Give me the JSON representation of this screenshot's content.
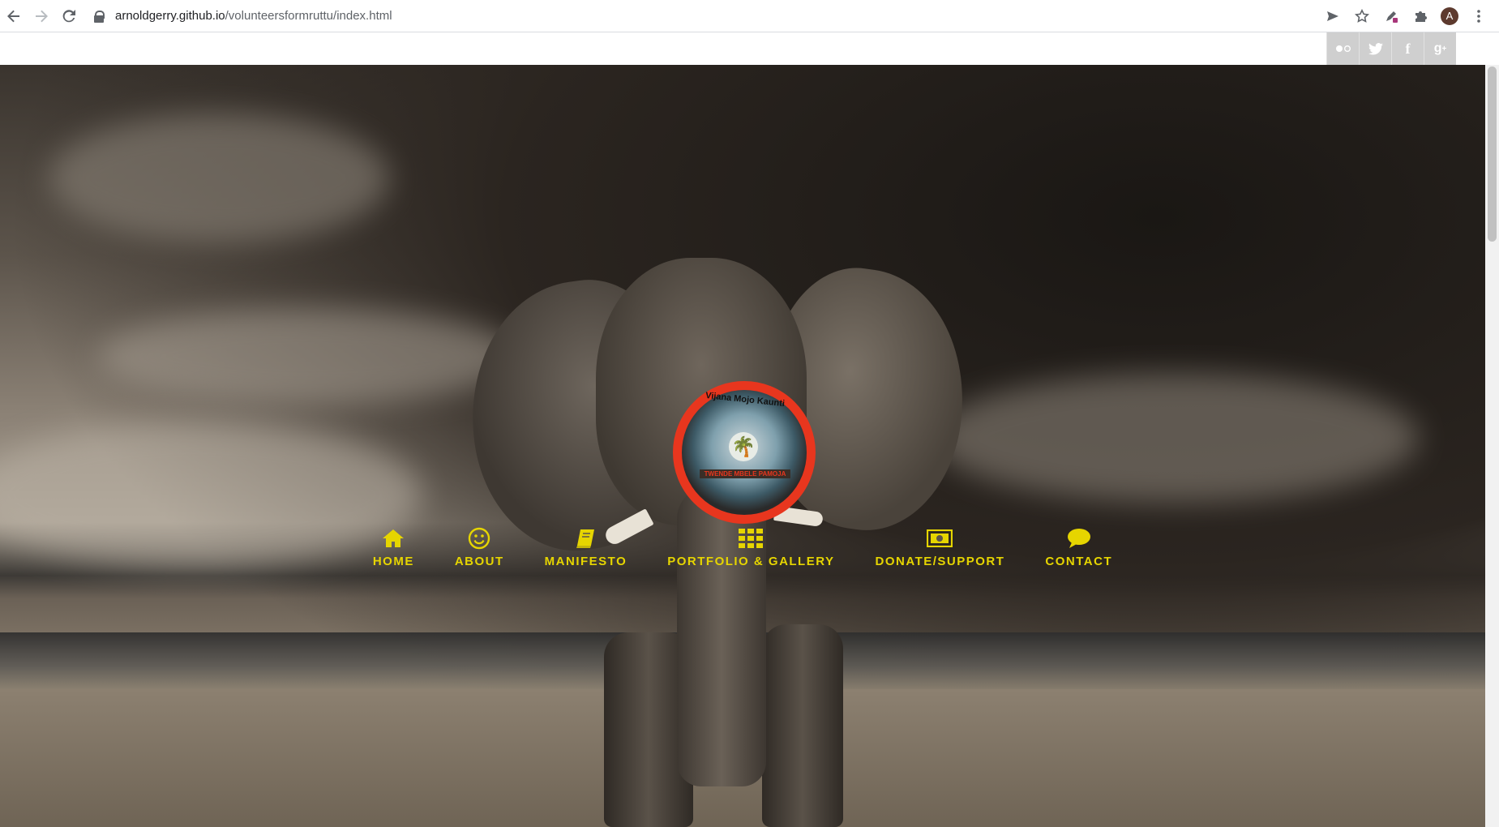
{
  "browser": {
    "url_host": "arnoldgerry.github.io",
    "url_path": "/volunteersformruttu/index.html",
    "avatar_letter": "A"
  },
  "social": {
    "items": [
      {
        "name": "flickr",
        "glyph": "●○"
      },
      {
        "name": "twitter",
        "glyph": "🐦"
      },
      {
        "name": "facebook",
        "glyph": "f"
      },
      {
        "name": "google-plus",
        "glyph": "g+"
      }
    ]
  },
  "logo": {
    "top_text": "Vijana Mojo Kaunti",
    "bottom_text": "TWENDE MBELE PAMOJA"
  },
  "nav": {
    "home": "HOME",
    "about": "ABOUT",
    "manifesto": "MANIFESTO",
    "portfolio": "PORTFOLIO & GALLERY",
    "donate": "DONATE/SUPPORT",
    "contact": "CONTACT"
  },
  "colors": {
    "nav_accent": "#e6d500",
    "logo_ring": "#e8361e",
    "social_bg": "#cfcfcf"
  }
}
